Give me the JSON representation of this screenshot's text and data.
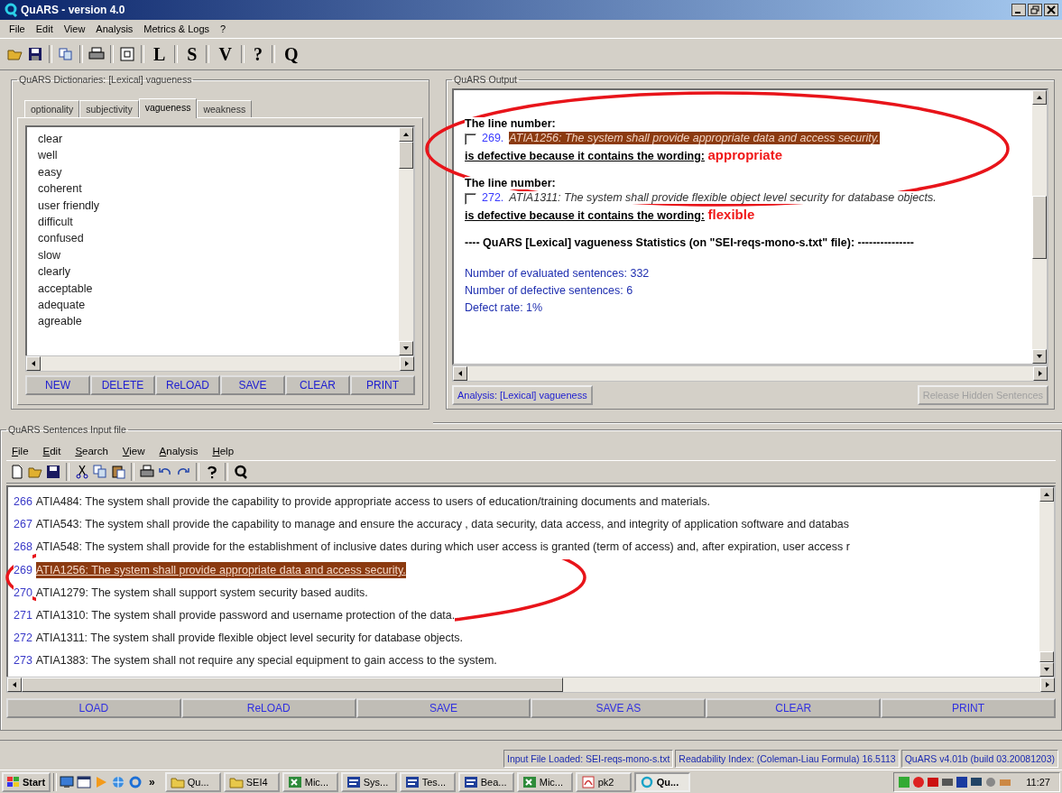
{
  "window": {
    "title": "QuARS - version 4.0"
  },
  "menu": [
    "File",
    "Edit",
    "View",
    "Analysis",
    "Metrics & Logs",
    "?"
  ],
  "toolbar_letters": [
    "L",
    "S",
    "V",
    "?",
    "Q"
  ],
  "dictionaries": {
    "legend": "QuARS Dictionaries: [Lexical] vagueness",
    "tabs": [
      {
        "label": "optionality",
        "selected": false
      },
      {
        "label": "subjectivity",
        "selected": false
      },
      {
        "label": "vagueness",
        "selected": true
      },
      {
        "label": "weakness",
        "selected": false
      }
    ],
    "words": [
      "clear",
      "well",
      "easy",
      "coherent",
      "user friendly",
      "difficult",
      "confused",
      "slow",
      "clearly",
      "acceptable",
      "adequate",
      "agreable"
    ],
    "buttons": [
      "NEW",
      "DELETE",
      "ReLOAD",
      "SAVE",
      "CLEAR",
      "PRINT"
    ]
  },
  "output": {
    "legend": "QuARS Output",
    "results": [
      {
        "heading": "The line number:",
        "checked": false,
        "line": "269.",
        "sentence": "ATIA1256: The system shall provide appropriate data and access security.",
        "highlighted": true,
        "defect_label": "is defective because it contains the wording:",
        "wording": "appropriate"
      },
      {
        "heading": "The line number:",
        "checked": false,
        "line": "272.",
        "sentence": "ATIA1311: The system shall provide flexible object level security for database objects.",
        "highlighted": false,
        "defect_label": "is defective because it contains the wording:",
        "wording": "flexible"
      }
    ],
    "stats_title": "----   QuARS [Lexical] vagueness Statistics (on \"SEI-reqs-mono-s.txt\" file): ---------------",
    "stats": [
      "Number of evaluated sentences: 332",
      "Number of defective sentences: 6",
      "Defect rate: 1%"
    ],
    "buttons": [
      {
        "label": "Analysis: [Lexical] vagueness",
        "disabled": false
      },
      {
        "label": "Release Hidden Sentences",
        "disabled": true
      }
    ]
  },
  "input": {
    "legend": "QuARS Sentences Input file",
    "menu": [
      "File",
      "Edit",
      "Search",
      "View",
      "Analysis",
      "Help"
    ],
    "lines": [
      {
        "number": "266",
        "text": "ATIA484: The system shall provide the capability to provide appropriate access to users of education/training documents and  materials.",
        "selected": false
      },
      {
        "number": "267",
        "text": "ATIA543: The system shall provide the capability to manage and ensure the accuracy , data security, data access, and integrity of application software and databas",
        "selected": false
      },
      {
        "number": "268",
        "text": "ATIA548: The system shall provide for the establishment of inclusive dates during which user access is granted (term of access) and, after expiration, user access r",
        "selected": false
      },
      {
        "number": "269",
        "text": "ATIA1256: The system shall provide appropriate data and access security.",
        "selected": true
      },
      {
        "number": "270",
        "text": "ATIA1279: The system shall support system security based audits.",
        "selected": false
      },
      {
        "number": "271",
        "text": "ATIA1310: The system shall provide password and username protection of the data.",
        "selected": false
      },
      {
        "number": "272",
        "text": "ATIA1311: The system shall provide flexible object level security for database objects.",
        "selected": false
      },
      {
        "number": "273",
        "text": "ATIA1383: The system shall not require any special equipment to gain access to the system.",
        "selected": false
      }
    ],
    "buttons": [
      "LOAD",
      "ReLOAD",
      "SAVE",
      "SAVE AS",
      "CLEAR",
      "PRINT"
    ]
  },
  "status_bar": [
    "Input File Loaded: SEI-reqs-mono-s.txt",
    "Readability Index: (Coleman-Liau Formula) 16.5113",
    "QuARS v4.01b (build 03.20081203)"
  ],
  "taskbar": {
    "start": "Start",
    "more": "»",
    "tasks": [
      {
        "label": "Qu...",
        "kind": "folder",
        "selected": false
      },
      {
        "label": "SEI4",
        "kind": "folder",
        "selected": false
      },
      {
        "label": "Mic...",
        "kind": "sheet",
        "selected": false
      },
      {
        "label": "Sys...",
        "kind": "doc",
        "selected": false
      },
      {
        "label": "Tes...",
        "kind": "doc",
        "selected": false
      },
      {
        "label": "Bea...",
        "kind": "doc",
        "selected": false
      },
      {
        "label": "Mic...",
        "kind": "sheet",
        "selected": false
      },
      {
        "label": "pk2",
        "kind": "pdf",
        "selected": false
      },
      {
        "label": "Qu...",
        "kind": "app",
        "selected": true
      }
    ],
    "clock": "11:27"
  }
}
